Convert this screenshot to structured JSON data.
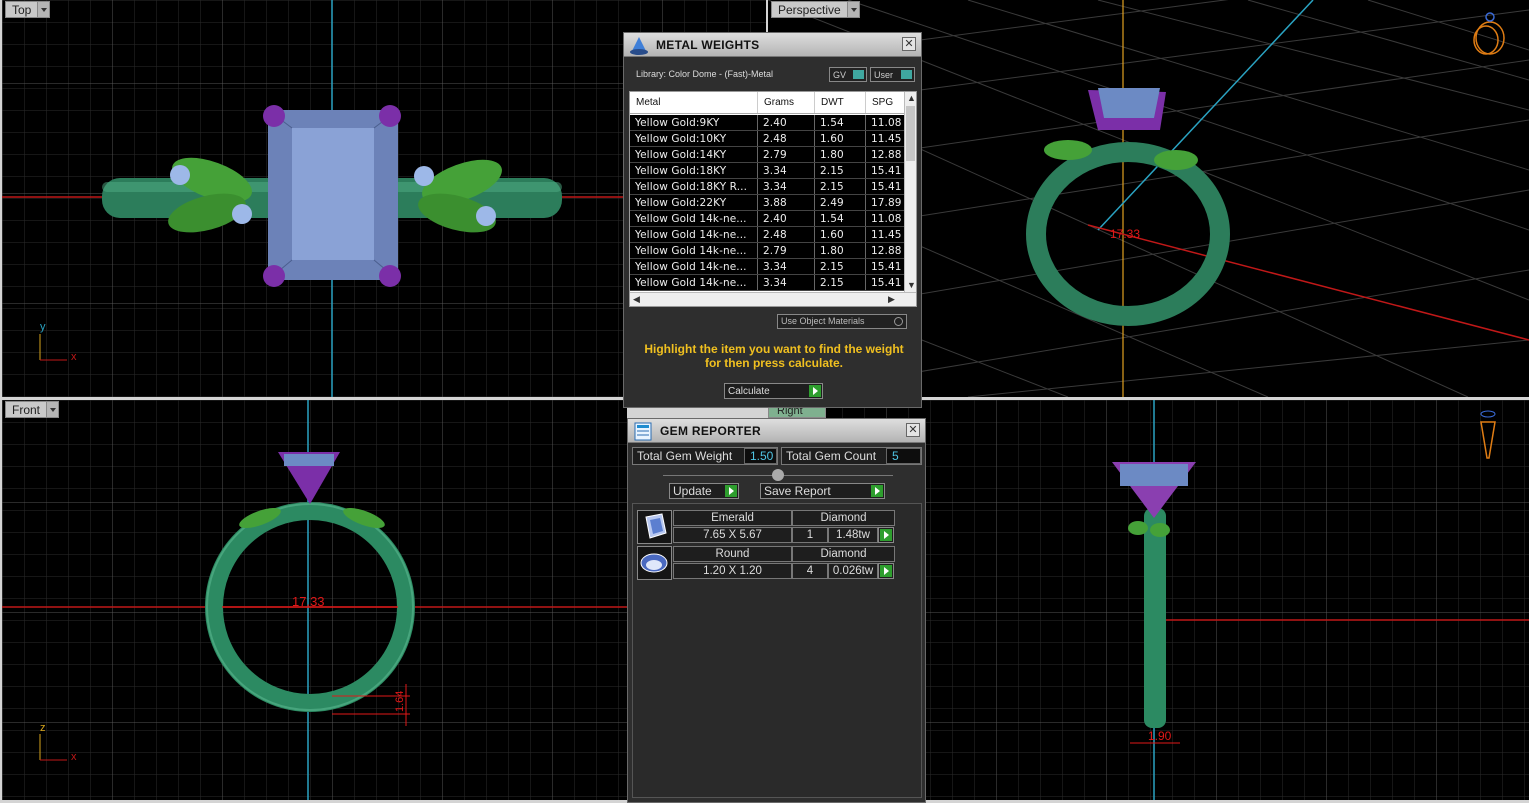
{
  "viewports": {
    "top": {
      "label": "Top",
      "axis_a": "y",
      "axis_b": "x"
    },
    "perspective": {
      "label": "Perspective",
      "dim_label": "17.33"
    },
    "front": {
      "label": "Front",
      "axis_a": "z",
      "axis_b": "x",
      "dim_label": "17.33",
      "small_dim": "1.64"
    },
    "right": {
      "label": "Right",
      "small_dim": "1.90"
    }
  },
  "metal_weights": {
    "title": "METAL WEIGHTS",
    "library": "Library: Color Dome - (Fast)-Metal",
    "toggle_gv": "GV",
    "toggle_user": "User",
    "columns": [
      "Metal",
      "Grams",
      "DWT",
      "SPG"
    ],
    "rows": [
      [
        "Yellow Gold:9KY",
        "2.40",
        "1.54",
        "11.08"
      ],
      [
        "Yellow Gold:10KY",
        "2.48",
        "1.60",
        "11.45"
      ],
      [
        "Yellow Gold:14KY",
        "2.79",
        "1.80",
        "12.88"
      ],
      [
        "Yellow Gold:18KY",
        "3.34",
        "2.15",
        "15.41"
      ],
      [
        "Yellow Gold:18KY R...",
        "3.34",
        "2.15",
        "15.41"
      ],
      [
        "Yellow Gold:22KY",
        "3.88",
        "2.49",
        "17.89"
      ],
      [
        "Yellow Gold 14k-ne...",
        "2.40",
        "1.54",
        "11.08"
      ],
      [
        "Yellow Gold 14k-ne...",
        "2.48",
        "1.60",
        "11.45"
      ],
      [
        "Yellow Gold 14k-ne...",
        "2.79",
        "1.80",
        "12.88"
      ],
      [
        "Yellow Gold 14k-ne...",
        "3.34",
        "2.15",
        "15.41"
      ],
      [
        "Yellow Gold 14k-ne...",
        "3.34",
        "2.15",
        "15.41"
      ]
    ],
    "use_object_materials": "Use Object Materials",
    "note_line1": "Highlight the item you want to find the weight",
    "note_line2": "for then press calculate.",
    "calculate_label": "Calculate"
  },
  "gem_reporter": {
    "title": "GEM REPORTER",
    "total_weight_label": "Total Gem Weight",
    "total_weight_value": "1.50",
    "total_count_label": "Total Gem Count",
    "total_count_value": "5",
    "update_label": "Update",
    "save_report_label": "Save Report",
    "gems": [
      {
        "shape": "Emerald",
        "material": "Diamond",
        "size": "7.65 X 5.67",
        "count": "1",
        "weight": "1.48tw"
      },
      {
        "shape": "Round",
        "material": "Diamond",
        "size": "1.20 X 1.20",
        "count": "4",
        "weight": "0.026tw"
      }
    ]
  },
  "colors": {
    "band": "#2f8a63",
    "prong": "#8a3fb0",
    "gem": "#6c8ac4",
    "leaf": "#4aa53c",
    "dim": "#e01818",
    "grid": "#3a3a3a"
  }
}
